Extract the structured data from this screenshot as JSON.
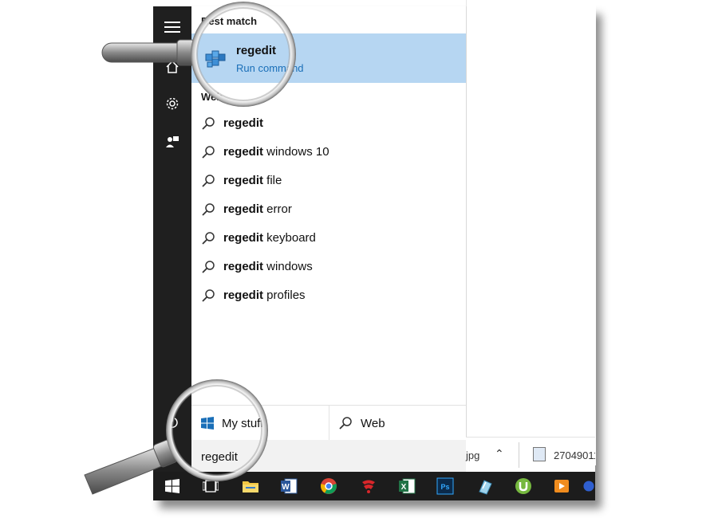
{
  "start_menu": {
    "rail": [
      {
        "icon": "hamburger-menu-icon"
      },
      {
        "icon": "home-icon"
      },
      {
        "icon": "gear-icon"
      },
      {
        "icon": "feedback-icon"
      },
      {
        "icon": "power-icon"
      }
    ],
    "best_match_label": "Best match",
    "best_match": {
      "title": "regedit",
      "subtitle": "Run command",
      "icon": "registry-editor-icon"
    },
    "web_label": "Web",
    "web_results": [
      {
        "bold": "regedit",
        "rest": ""
      },
      {
        "bold": "regedit",
        "rest": " windows 10"
      },
      {
        "bold": "regedit",
        "rest": " file"
      },
      {
        "bold": "regedit",
        "rest": " error"
      },
      {
        "bold": "regedit",
        "rest": " keyboard"
      },
      {
        "bold": "regedit",
        "rest": " windows"
      },
      {
        "bold": "regedit",
        "rest": " profiles"
      }
    ],
    "scope": {
      "my_stuff_label": "My stuff",
      "web_label": "Web"
    },
    "search": {
      "value": "regedit"
    }
  },
  "desktop": {
    "file_ext": "jpg",
    "file_name": "27049011"
  },
  "taskbar": {
    "icons": [
      "windows-start-icon",
      "task-view-icon",
      "file-explorer-icon",
      "word-icon",
      "chrome-icon",
      "garena-icon",
      "excel-icon",
      "photoshop-icon",
      "paint-icon",
      "utorrent-icon",
      "media-player-icon",
      "app-icon"
    ]
  },
  "colors": {
    "highlight": "#b6d6f2",
    "accent": "#1a6fb8",
    "rail": "#1f1f1f",
    "taskbar": "#1c1c1c"
  }
}
